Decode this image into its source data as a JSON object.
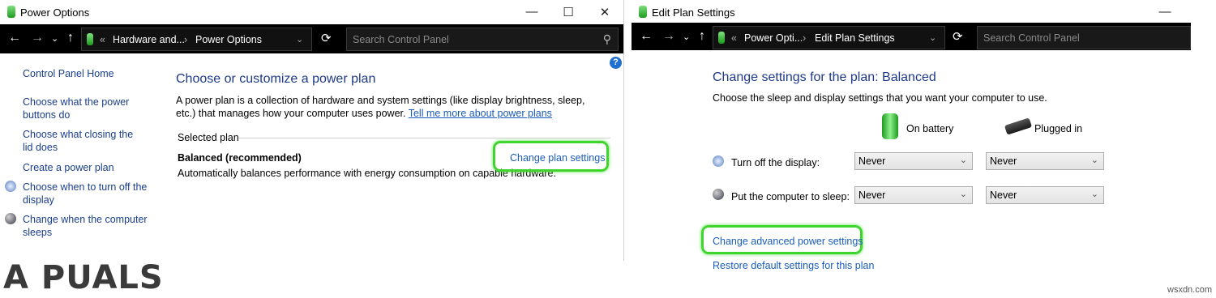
{
  "window1": {
    "title": "Power Options",
    "breadcrumb": [
      "Hardware and...",
      "Power Options"
    ],
    "search_placeholder": "Search Control Panel",
    "sidebar": [
      {
        "label": "Control Panel Home"
      },
      {
        "label": "Choose what the power buttons do"
      },
      {
        "label": "Choose what closing the lid does"
      },
      {
        "label": "Create a power plan"
      },
      {
        "label": "Choose when to turn off the display"
      },
      {
        "label": "Change when the computer sleeps"
      }
    ],
    "main": {
      "heading": "Choose or customize a power plan",
      "description": "A power plan is a collection of hardware and system settings (like display brightness, sleep, etc.) that manages how your computer uses power.",
      "tell_me_link": "Tell me more about power plans",
      "selected_plan_label": "Selected plan",
      "plan_name": "Balanced (recommended)",
      "plan_desc": "Automatically balances performance with energy consumption on capable hardware.",
      "change_plan_link": "Change plan settings"
    }
  },
  "window2": {
    "title": "Edit Plan Settings",
    "breadcrumb": [
      "Power Opti...",
      "Edit Plan Settings"
    ],
    "search_placeholder": "Search Control Panel",
    "heading": "Change settings for the plan: Balanced",
    "subheading": "Choose the sleep and display settings that you want your computer to use.",
    "col_on_battery": "On battery",
    "col_plugged_in": "Plugged in",
    "rows": [
      {
        "label": "Turn off the display:",
        "battery": "Never",
        "plugged": "Never"
      },
      {
        "label": "Put the computer to sleep:",
        "battery": "Never",
        "plugged": "Never"
      }
    ],
    "advanced_link": "Change advanced power settings",
    "restore_link": "Restore default settings for this plan"
  },
  "branding": {
    "logo": "A  PUALS",
    "watermark": "wsxdn.com"
  },
  "colors": {
    "highlight": "#3fd42e",
    "link": "#1a5cb8",
    "heading": "#1e3a8a"
  }
}
